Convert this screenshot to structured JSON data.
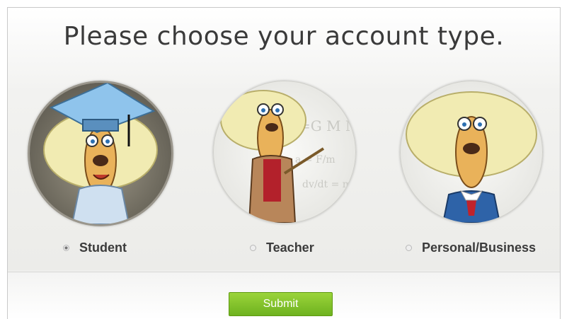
{
  "page": {
    "title": "Please choose your account type."
  },
  "options": [
    {
      "label": "Student",
      "selected": true,
      "illustration": "student-character-icon"
    },
    {
      "label": "Teacher",
      "selected": false,
      "illustration": "teacher-character-icon"
    },
    {
      "label": "Personal/Business",
      "selected": false,
      "illustration": "business-character-icon"
    }
  ],
  "form": {
    "submit_label": "Submit"
  },
  "colors": {
    "submit_top": "#9bd43a",
    "submit_bottom": "#6eb21f",
    "graduation_cap": "#8fc4ec"
  }
}
